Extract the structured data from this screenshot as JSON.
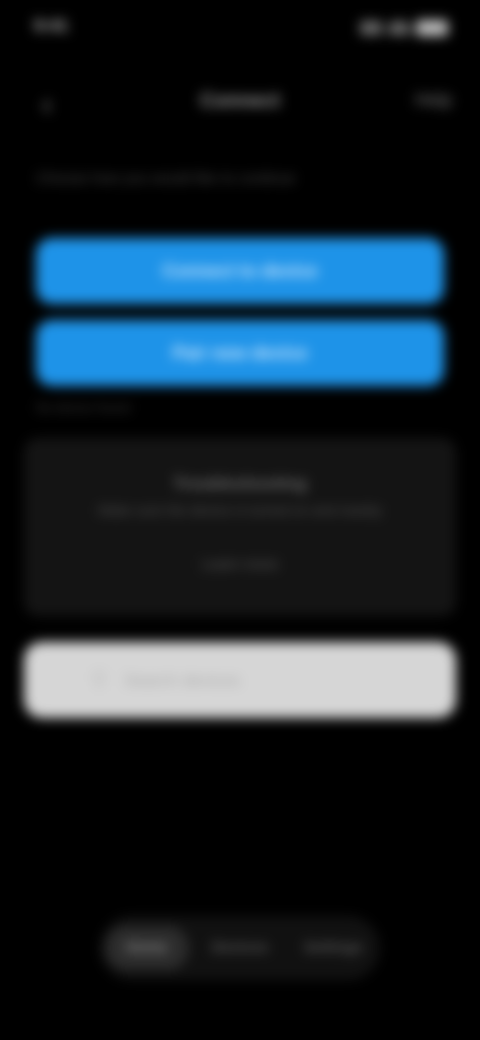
{
  "status_bar": {
    "time": "9:41"
  },
  "header": {
    "back_icon": "chevron-left-icon",
    "title": "Connect",
    "action_label": "Help"
  },
  "main": {
    "section_label": "Choose how you would like to continue",
    "primary_button_1": "Connect to device",
    "primary_button_2": "Pair new device",
    "small_label": "No device found",
    "card": {
      "title": "Troubleshooting",
      "description": "Make sure the device is turned on and nearby",
      "link": "Learn more"
    },
    "search": {
      "icon": "search-icon",
      "placeholder": "Search devices"
    }
  },
  "tabs": [
    {
      "label": "Home",
      "active": true
    },
    {
      "label": "Devices",
      "active": false
    },
    {
      "label": "Settings",
      "active": false
    }
  ],
  "colors": {
    "accent": "#1e93e8",
    "background": "#000000",
    "card": "#141414",
    "search_bar": "#d6d6d6"
  }
}
